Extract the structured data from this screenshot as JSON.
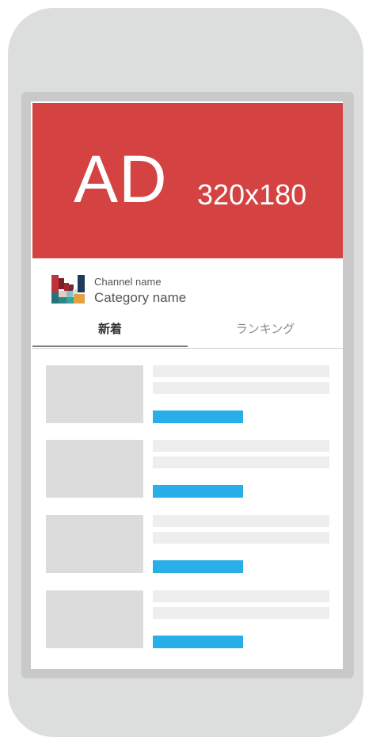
{
  "ad": {
    "label": "AD",
    "size": "320x180",
    "color": "#d44242"
  },
  "channel": {
    "logo_icon": "channel-logo-icon",
    "channel_name": "Channel name",
    "category_name": "Category name"
  },
  "tabs": [
    {
      "label": "新着",
      "active": true
    },
    {
      "label": "ランキング",
      "active": false
    }
  ],
  "list": {
    "item_count": 4,
    "link_color": "#29aeea"
  }
}
